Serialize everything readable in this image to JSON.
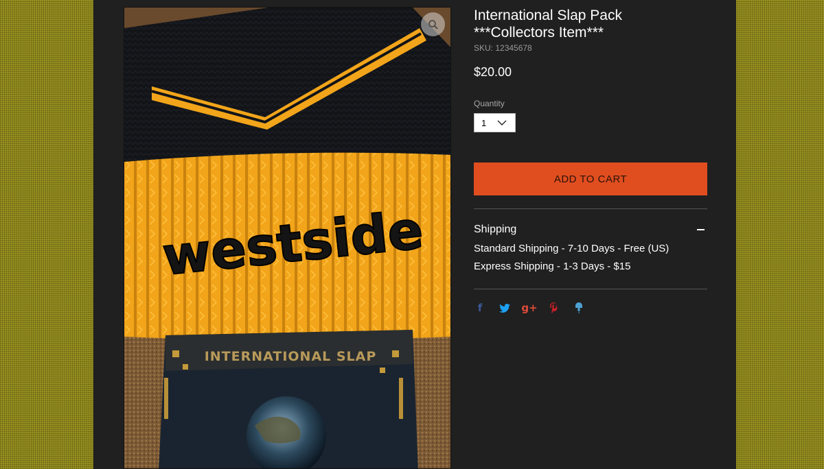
{
  "product": {
    "title_line1": "International Slap Pack",
    "title_line2": "***Collectors Item***",
    "sku": "SKU: 12345678",
    "price": "$20.00",
    "image_text": {
      "hat_text": "westside",
      "cd_text": "INTERNATIONAL SLAP"
    }
  },
  "quantity": {
    "label": "Quantity",
    "selected": "1"
  },
  "cart": {
    "button_label": "ADD TO CART"
  },
  "shipping": {
    "title": "Shipping",
    "lines": [
      "Standard Shipping - 7-10 Days - Free (US)",
      "Express Shipping - 1-3 Days - $15"
    ]
  },
  "social": {
    "facebook": "f",
    "google_plus": "g+"
  },
  "colors": {
    "page_background": "#9a9220",
    "panel": "#202020",
    "add_to_cart": "#e04e20",
    "hat_yellow": "#f2a51a",
    "facebook": "#3b5998",
    "twitter": "#1da1f2",
    "google_plus": "#dd4b39",
    "pinterest": "#cb2027",
    "fancy": "#4ea1d3"
  },
  "icons": [
    "zoom-icon",
    "chevron-down-icon",
    "collapse-icon",
    "facebook-icon",
    "twitter-icon",
    "google-plus-icon",
    "pinterest-icon",
    "fancy-icon"
  ]
}
